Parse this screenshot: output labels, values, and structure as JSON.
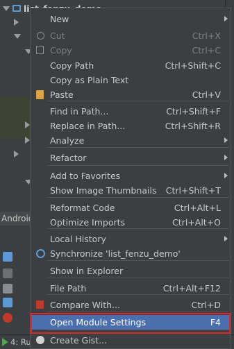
{
  "project": {
    "root_label": "list_fenzu_demo",
    "android_tab": "Android"
  },
  "status_bar": {
    "run_tab_label": "4: Ru"
  },
  "menu": {
    "items": [
      {
        "label": "New",
        "shortcut": "",
        "submenu": true
      },
      {
        "label": "Cut",
        "shortcut": "Ctrl+X",
        "disabled": true,
        "icon": "scissors-icon"
      },
      {
        "label": "Copy",
        "shortcut": "Ctrl+C",
        "disabled": true,
        "icon": "copy-icon"
      },
      {
        "label": "Copy Path",
        "shortcut": "Ctrl+Shift+C"
      },
      {
        "label": "Copy as Plain Text",
        "shortcut": ""
      },
      {
        "label": "Paste",
        "shortcut": "Ctrl+V",
        "icon": "clipboard-icon"
      },
      {
        "label": "Find in Path...",
        "shortcut": "Ctrl+Shift+F"
      },
      {
        "label": "Replace in Path...",
        "shortcut": "Ctrl+Shift+R"
      },
      {
        "label": "Analyze",
        "shortcut": "",
        "submenu": true
      },
      {
        "label": "Refactor",
        "shortcut": "",
        "submenu": true
      },
      {
        "label": "Add to Favorites",
        "shortcut": "",
        "submenu": true
      },
      {
        "label": "Show Image Thumbnails",
        "shortcut": "Ctrl+Shift+T"
      },
      {
        "label": "Reformat Code",
        "shortcut": "Ctrl+Alt+L"
      },
      {
        "label": "Optimize Imports",
        "shortcut": "Ctrl+Alt+O"
      },
      {
        "label": "Local History",
        "shortcut": "",
        "submenu": true
      },
      {
        "label": "Synchronize 'list_fenzu_demo'",
        "shortcut": "",
        "icon": "sync-icon"
      },
      {
        "label": "Show in Explorer",
        "shortcut": ""
      },
      {
        "label": "File Path",
        "shortcut": "Ctrl+Alt+F12"
      },
      {
        "label": "Compare With...",
        "shortcut": "Ctrl+D",
        "icon": "compare-icon"
      },
      {
        "label": "Open Module Settings",
        "shortcut": "F4",
        "selected": true
      },
      {
        "label": "Create Gist...",
        "shortcut": "",
        "icon": "github-icon"
      }
    ]
  },
  "colors": {
    "menu_bg": "#3c3f41",
    "selection": "#4b6eaf",
    "highlight_outline": "#e0252b"
  }
}
